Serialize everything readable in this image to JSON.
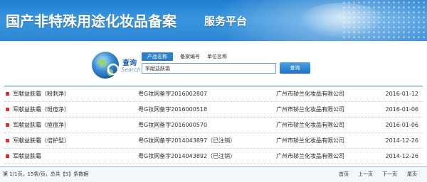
{
  "header": {
    "title": "国产非特殊用途化妆品备案",
    "subtitle": "服务平台"
  },
  "search": {
    "title": "查询",
    "title_en": "Search",
    "tabs": [
      {
        "label": "产品名称",
        "active": true
      },
      {
        "label": "备案编号",
        "active": false
      },
      {
        "label": "单位名称",
        "active": false
      }
    ],
    "value": "军献益肤霜",
    "button_label": "查询"
  },
  "results": [
    {
      "name": "军献益肤霜（粉刺净）",
      "code": "粤G妆网备字2016002807",
      "company": "广州市轿兰化妆品有限公司",
      "date": "2016-01-12"
    },
    {
      "name": "军献益肤霜（斑痘净）",
      "code": "粤G妆网备字2016000518",
      "company": "广州市轿兰化妆品有限公司",
      "date": "2016-01-06"
    },
    {
      "name": "军献益肤霜（痘痘净）",
      "code": "粤G妆网备字2016000570",
      "company": "广州市轿兰化妆品有限公司",
      "date": "2016-01-06"
    },
    {
      "name": "军献益肤霜（倍护型）",
      "code": "粤G妆网备字2014043897（已注销）",
      "company": "广州市轿兰化妆品有限公司",
      "date": "2014-12-26"
    },
    {
      "name": "军献益肤霜",
      "code": "粤G妆网备字2014043892（已注销）",
      "company": "广州市轿兰化妆品有限公司",
      "date": "2014-12-26"
    }
  ],
  "footer": {
    "info": "第 1/1页，15条/页，总共【5】条数据",
    "first": "首页",
    "prev": "上一页",
    "next": "下一页",
    "last": "尾页"
  },
  "colors": {
    "accent": "#2d7fc8",
    "bullet": "#d8322b"
  }
}
